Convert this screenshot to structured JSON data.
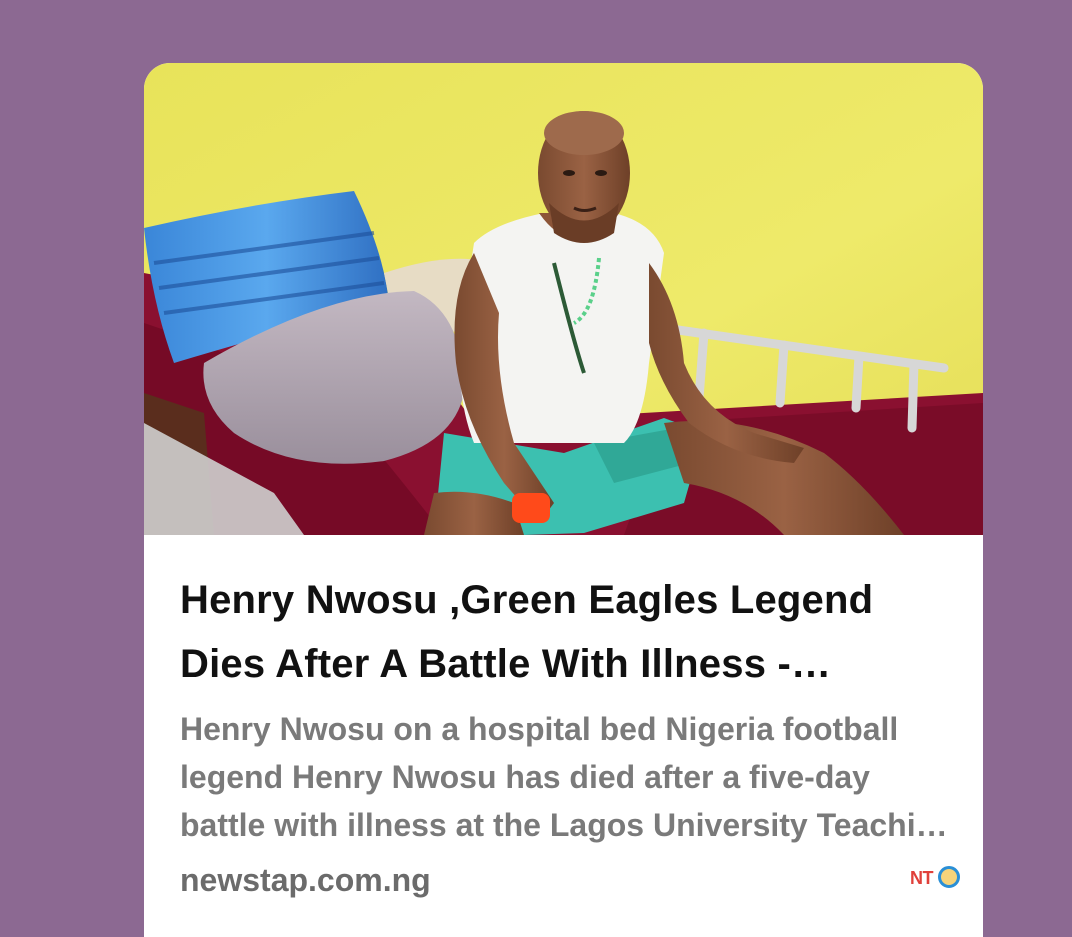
{
  "card": {
    "image_alt": "Henry Nwosu on a hospital bed",
    "title": "Henry Nwosu ,Green Eagles Legend Dies After A Battle With Illness - Newstap",
    "description": "Henry Nwosu on a hospital bed Nigeria football legend Henry Nwosu has died after a five-day battle with illness at the Lagos University Teaching Hospital",
    "domain": "newstap.com.ng",
    "favicon_text": "NT"
  },
  "colors": {
    "background": "#8c6992",
    "card": "#ffffff",
    "title": "#111111",
    "description": "#7a7a7a",
    "domain": "#6b6b6b",
    "favicon_red": "#e0403a",
    "favicon_blue": "#2a8fd6"
  }
}
